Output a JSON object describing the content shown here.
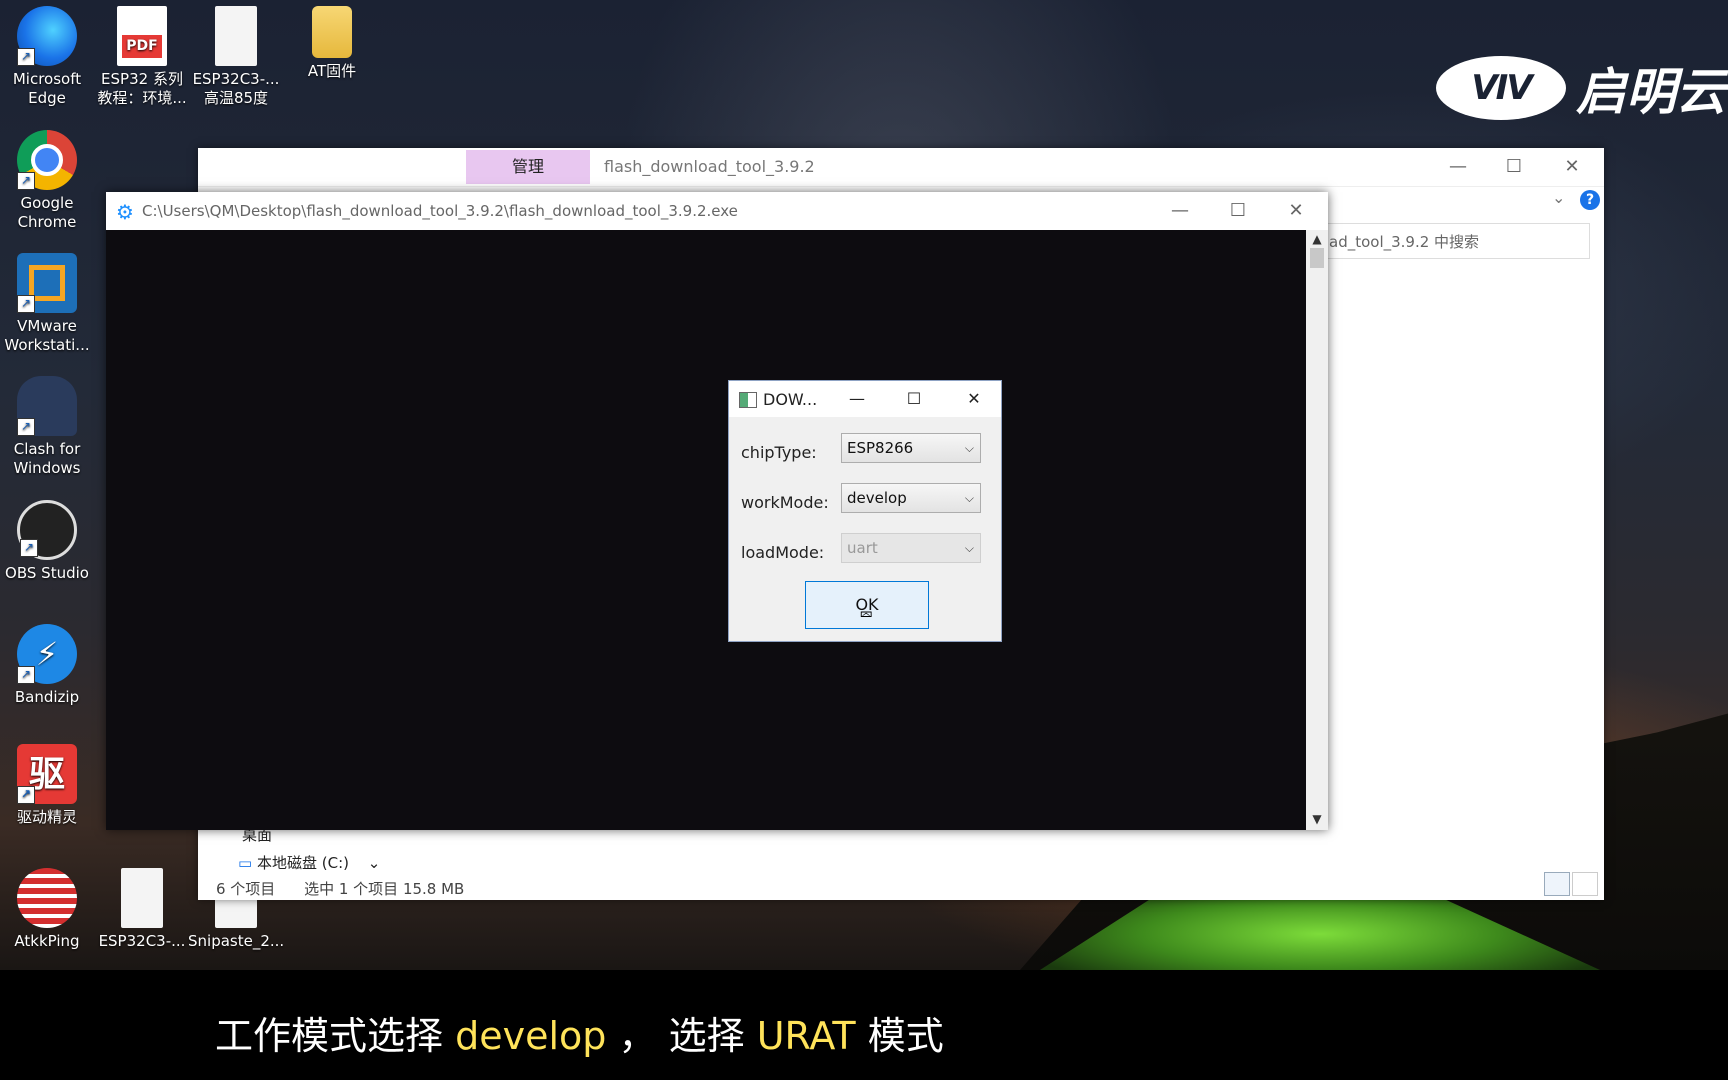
{
  "desktop": {
    "logo_mark": "VIV",
    "logo_text": "启明云端",
    "icons": [
      {
        "label": "Microsoft Edge",
        "icon": "edge-icon"
      },
      {
        "label": "ESP32 系列 教程：环境...",
        "icon": "pdf-icon"
      },
      {
        "label": "ESP32C3-... 高温85度",
        "icon": "file-icon"
      },
      {
        "label": "AT固件",
        "icon": "folder-icon"
      },
      {
        "label": "Google Chrome",
        "icon": "chrome-icon"
      },
      {
        "label": "VMware Workstati...",
        "icon": "vmware-icon"
      },
      {
        "label": "Clash for Windows",
        "icon": "clash-icon"
      },
      {
        "label": "OBS Studio",
        "icon": "obs-icon"
      },
      {
        "label": "Bandizip",
        "icon": "bandizip-icon"
      },
      {
        "label": "驱动精灵",
        "icon": "driver-icon"
      },
      {
        "label": "AtkkPing",
        "icon": "atkkping-icon"
      },
      {
        "label": "ESP32C3-...",
        "icon": "file-icon"
      },
      {
        "label": "Snipaste_2...",
        "icon": "image-icon"
      }
    ],
    "pdf_badge": "PDF",
    "driver_glyph": "驱"
  },
  "explorer": {
    "manage_tab": "管理",
    "title": "flash_download_tool_3.9.2",
    "search_placeholder": "ad_tool_3.9.2 中搜索",
    "help": "?",
    "nav_desktop": "桌面",
    "nav_drive": "本地磁盘 (C:)",
    "status_items": "6 个项目",
    "status_selected": "选中 1 个项目  15.8 MB"
  },
  "flash_tool": {
    "title": "C:\\Users\\QM\\Desktop\\flash_download_tool_3.9.2\\flash_download_tool_3.9.2.exe"
  },
  "dialog": {
    "title": "DOW...",
    "chip_label": "chipType:",
    "chip_value": "ESP8266",
    "work_label": "workMode:",
    "work_value": "develop",
    "load_label": "loadMode:",
    "load_value": "uart",
    "ok": "OK"
  },
  "subtitle": {
    "part1": "工作模式选择",
    "hl1": "develop",
    "part2": "， 选择",
    "hl2": "URAT",
    "part3": "模式"
  }
}
